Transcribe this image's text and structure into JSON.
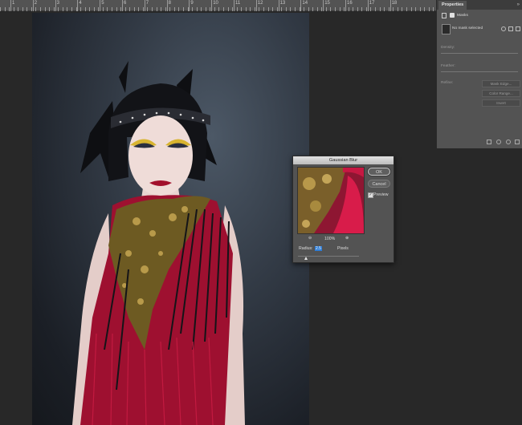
{
  "ruler": {
    "numbers": [
      "1",
      "2",
      "3",
      "4",
      "5",
      "6",
      "7",
      "8",
      "9",
      "10",
      "11",
      "12",
      "13",
      "14",
      "15",
      "16",
      "17",
      "18"
    ]
  },
  "properties": {
    "tab": "Properties",
    "collapse_glyph": "»",
    "section": "Masks",
    "mask_status": "No mask selected",
    "density_label": "Density:",
    "feather_label": "Feather:",
    "refine_label": "Refine:",
    "buttons": {
      "mask_edge": "Mask Edge...",
      "color_range": "Color Range...",
      "invert": "Invert"
    }
  },
  "dialog": {
    "title": "Gaussian Blur",
    "ok": "OK",
    "cancel": "Cancel",
    "preview_label": "Preview",
    "preview_checked": true,
    "zoom": "100%",
    "radius_label": "Radius:",
    "radius_value": "2.5",
    "unit": "Pixels"
  },
  "colors": {
    "panel": "#535353",
    "workspace": "#282828",
    "accent": "#2f7dd6"
  }
}
